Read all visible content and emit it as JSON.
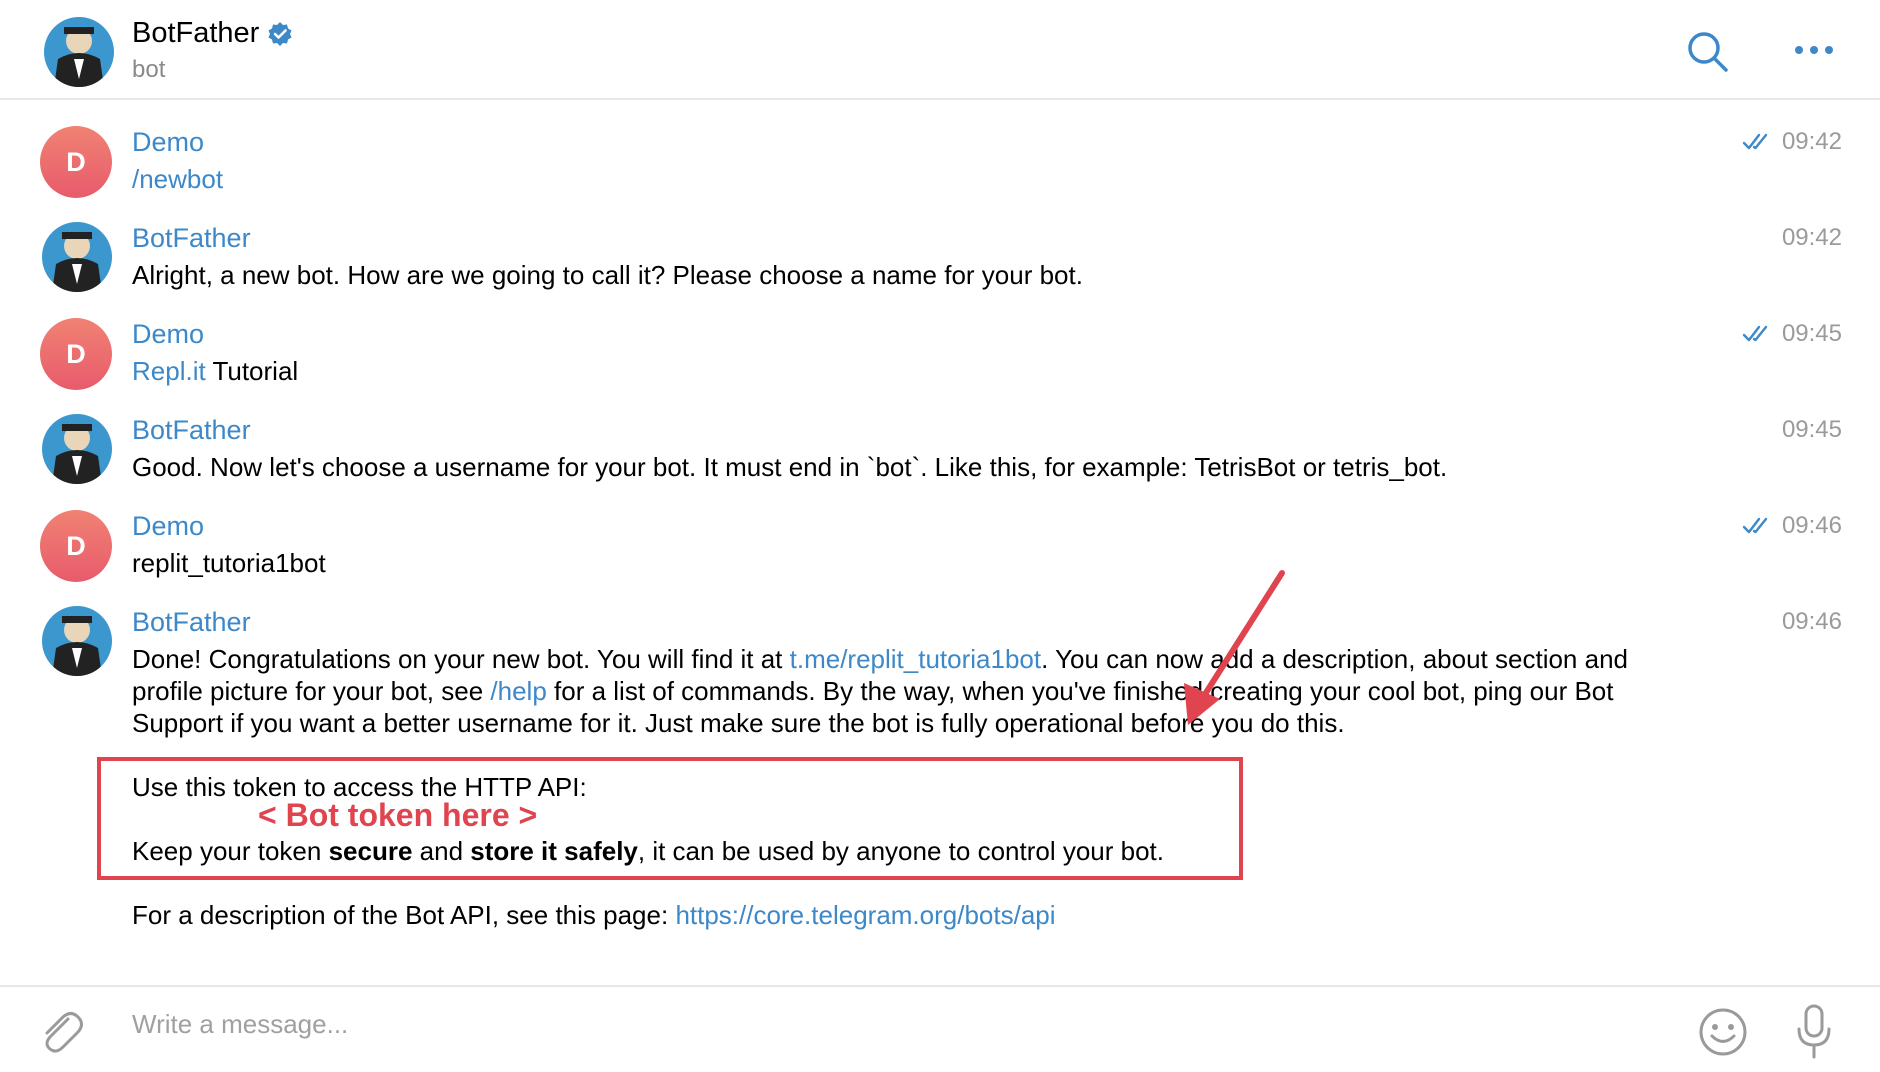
{
  "header": {
    "title": "BotFather",
    "subtitle": "bot",
    "icons": [
      "verified-badge-icon",
      "search-icon",
      "more-options-icon"
    ]
  },
  "messages": [
    {
      "sender": "Demo",
      "time": "09:42",
      "read": true,
      "text": "/newbot"
    },
    {
      "sender": "BotFather",
      "time": "09:42",
      "text": "Alright, a new bot. How are we going to call it? Please choose a name for your bot."
    },
    {
      "sender": "Demo",
      "time": "09:45",
      "read": true,
      "link": "Repl.it",
      "text": " Tutorial"
    },
    {
      "sender": "BotFather",
      "time": "09:45",
      "text": "Good. Now let's choose a username for your bot. It must end in `bot`. Like this, for example: TetrisBot or tetris_bot."
    },
    {
      "sender": "Demo",
      "time": "09:46",
      "read": true,
      "text": "replit_tutoria1bot"
    },
    {
      "sender": "BotFather",
      "time": "09:46",
      "p1a": "Done! Congratulations on your new bot. You will find it at ",
      "p1link": "t.me/replit_tutoria1bot",
      "p1b": ". You can now add a description, about section and",
      "p2a": "profile picture for your bot, see ",
      "p2link": "/help",
      "p2b": " for a list of commands. By the way, when you've finished creating your cool bot, ping our Bot",
      "p3": "Support if you want a better username for it. Just make sure the bot is fully operational before you do this.",
      "token_intro": "Use this token to access the HTTP API:",
      "keep_a": "Keep your token ",
      "keep_b1": "secure",
      "keep_c": " and ",
      "keep_b2": "store it safely",
      "keep_d": ", it can be used by anyone to control your bot.",
      "api_text": "For a description of the Bot API, see this page: ",
      "api_link": "https://core.telegram.org/bots/api"
    }
  ],
  "avatar_initial": "D",
  "annotation": {
    "token_label": "< Bot token here  >",
    "color": "#e0444f"
  },
  "composer": {
    "placeholder": "Write a message...",
    "icons": [
      "attach-icon",
      "emoji-icon",
      "microphone-icon"
    ]
  },
  "colors": {
    "link": "#3d88c8",
    "accent": "#3d88c8",
    "avatar_gradient": [
      "#f08273",
      "#e85b6c"
    ]
  }
}
